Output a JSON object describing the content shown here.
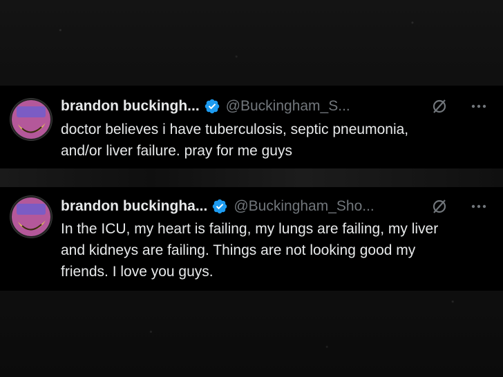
{
  "tweets": [
    {
      "name": "brandon buckingh...",
      "handle": "@Buckingham_S...",
      "lines": [
        "doctor believes i have tuberculosis, septic pneumonia,",
        "and/or liver failure. pray for me guys"
      ]
    },
    {
      "name": "brandon buckingha...",
      "handle": "@Buckingham_Sho...",
      "lines": [
        "In the ICU, my heart is failing, my lungs are failing, my liver",
        "and kidneys are failing. Things are not looking good my",
        "friends. I love you guys."
      ]
    }
  ],
  "icons": {
    "verified": "verified-badge-icon",
    "grok": "grok-icon",
    "more": "more-options-icon"
  },
  "colors": {
    "background": "#000000",
    "text": "#e7e9ea",
    "secondary": "#71767b",
    "verified": "#1d9bf0"
  }
}
